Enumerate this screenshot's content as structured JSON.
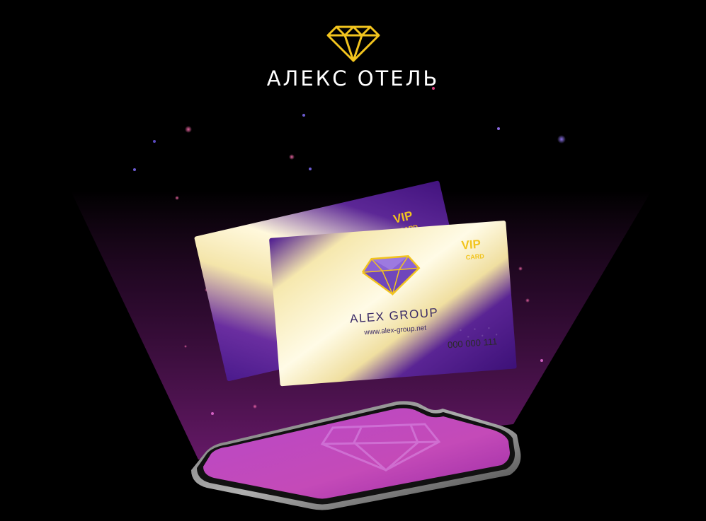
{
  "brand": {
    "name": "АЛЕКС ОТЕЛЬ",
    "logo_icon": "diamond-icon",
    "accent_color": "#f2c41e"
  },
  "cards": [
    {
      "vip": "VIP",
      "card": "CARD",
      "company": "ALEX GROUP",
      "website": "www.alex-group.net",
      "number": "000 000 111"
    },
    {
      "vip": "VIP",
      "card": "CARD"
    }
  ],
  "colors": {
    "background": "#000000",
    "purple": "#4a1a8c",
    "gold": "#f5e6a8",
    "screen": "#c046c0"
  }
}
